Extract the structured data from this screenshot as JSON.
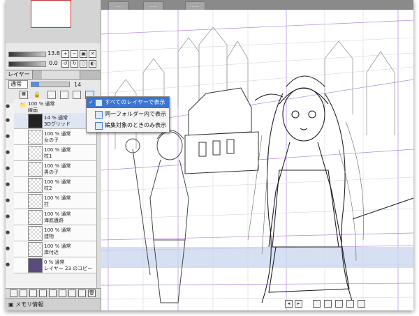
{
  "doc_tabs": [
    {
      "label": "....."
    },
    {
      "label": "....."
    },
    {
      "label": "....."
    }
  ],
  "toolbar": {
    "brush_size": "13.8",
    "opacity": "0.0",
    "blend_mode": "通常",
    "layer_opacity": "14"
  },
  "panel_tabs": {
    "layer_tab": "レイヤー"
  },
  "folder": {
    "opacity": "100 % 通常",
    "name": "線画"
  },
  "popup": {
    "items": [
      {
        "label": "すべてのレイヤーで表示",
        "checked": "✓"
      },
      {
        "label": "同一フォルダー内で表示",
        "checked": ""
      },
      {
        "label": "編集対象のときのみ表示",
        "checked": ""
      }
    ]
  },
  "layers": [
    {
      "opacity": "14 % 通常",
      "name": "3Dグリッド"
    },
    {
      "opacity": "100 % 通常",
      "name": "女の子"
    },
    {
      "opacity": "100 % 通常",
      "name": "杖1"
    },
    {
      "opacity": "100 % 通常",
      "name": "男の子"
    },
    {
      "opacity": "100 % 通常",
      "name": "杖2"
    },
    {
      "opacity": "100 % 通常",
      "name": "柱"
    },
    {
      "opacity": "100 % 通常",
      "name": "海底遺跡"
    },
    {
      "opacity": "100 % 通常",
      "name": "建物"
    },
    {
      "opacity": "100 % 通常",
      "name": "岸付近"
    },
    {
      "opacity": "0 % 通常",
      "name": "レイヤー 23 のコピー"
    }
  ],
  "status": {
    "memory_label": "メモリ情報"
  },
  "colors": {
    "grid_line": "#9c6bd6",
    "popup_highlight": "#3b74d1",
    "water": "#c8d6ee"
  }
}
